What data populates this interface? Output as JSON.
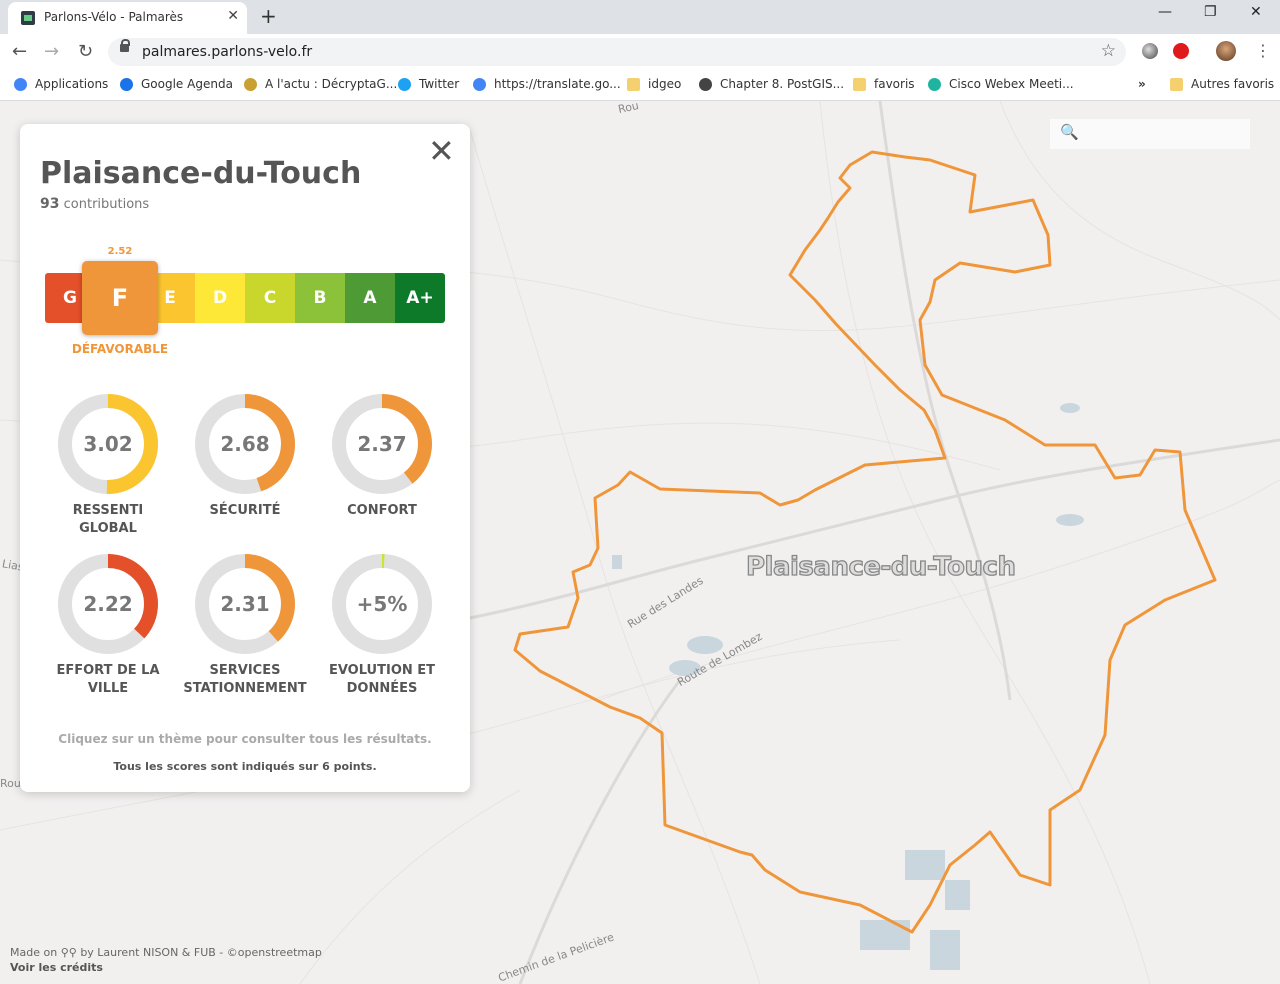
{
  "browser": {
    "tab_title": "Parlons-Vélo - Palmarès",
    "url": "palmares.parlons-velo.fr",
    "bookmarks": [
      {
        "label": "Applications",
        "icon": "apps-grid-icon",
        "color": "#4285f4"
      },
      {
        "label": "Google Agenda",
        "icon": "calendar-icon",
        "color": "#1a73e8"
      },
      {
        "label": "A l'actu : DécryptaG...",
        "icon": "location-pin-icon",
        "color": "#c8a033"
      },
      {
        "label": "Twitter",
        "icon": "twitter-icon",
        "color": "#1da1f2"
      },
      {
        "label": "https://translate.go...",
        "icon": "translate-icon",
        "color": "#4285f4"
      },
      {
        "label": "idgeo",
        "icon": "folder-icon",
        "color": "#f4d06f"
      },
      {
        "label": "Chapter 8. PostGIS...",
        "icon": "globe-icon",
        "color": "#444444"
      },
      {
        "label": "favoris",
        "icon": "folder-icon",
        "color": "#f4d06f"
      },
      {
        "label": "Cisco Webex Meeti...",
        "icon": "webex-icon",
        "color": "#1eb4a0"
      }
    ],
    "more_bookmarks": "»",
    "other_bookmarks": "Autres favoris"
  },
  "panel": {
    "city": "Plaisance-du-Touch",
    "contributions_count": "93",
    "contributions_label": "contributions",
    "grade": {
      "letter": "F",
      "score": "2.52",
      "label": "DÉFAVORABLE",
      "color": "#f0963a",
      "scale": [
        {
          "letter": "G",
          "color": "#e4502a"
        },
        {
          "letter": "F",
          "color": "#f0963a"
        },
        {
          "letter": "E",
          "color": "#fbc530"
        },
        {
          "letter": "D",
          "color": "#fde838"
        },
        {
          "letter": "C",
          "color": "#c9d62b"
        },
        {
          "letter": "B",
          "color": "#8cc23a"
        },
        {
          "letter": "A",
          "color": "#4e9a35"
        },
        {
          "letter": "A+",
          "color": "#0d7a2a"
        }
      ]
    },
    "themes": [
      {
        "value": "3.02",
        "score": 3.02,
        "label": "RESSENTI\nGLOBAL",
        "color": "#fbc530"
      },
      {
        "value": "2.68",
        "score": 2.68,
        "label": "SÉCURITÉ",
        "color": "#f0963a"
      },
      {
        "value": "2.37",
        "score": 2.37,
        "label": "CONFORT",
        "color": "#f0963a"
      },
      {
        "value": "2.22",
        "score": 2.22,
        "label": "EFFORT DE LA\nVILLE",
        "color": "#e4502a"
      },
      {
        "value": "2.31",
        "score": 2.31,
        "label": "SERVICES\nSTATIONNEMENT",
        "color": "#f0963a"
      },
      {
        "value": "+5%",
        "score": 0.05,
        "label": "EVOLUTION ET\nDONNÉES",
        "color": "#c5e82a"
      }
    ],
    "hint": "Cliquez sur un thème pour consulter tous les résultats.",
    "note": "Tous les scores sont indiqués sur 6 points."
  },
  "map": {
    "place_label": "Plaisance-du-Touch",
    "boundary_color": "#f0963a",
    "roads": [
      "Rue des Landes",
      "Route de Lombez",
      "Chemin de la Pelicière",
      "Lias",
      "Rout",
      "Rou"
    ]
  },
  "footer": {
    "made_by": "Made on",
    "authors": "by Laurent NISON & FUB - ©openstreetmap",
    "credits_link": "Voir les crédits"
  }
}
